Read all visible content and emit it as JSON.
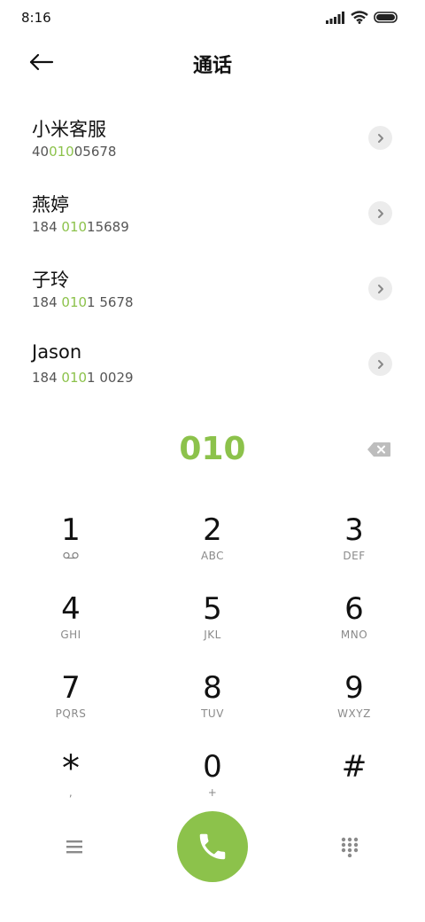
{
  "status_bar": {
    "time": "8:16"
  },
  "header": {
    "title": "通话"
  },
  "contacts": [
    {
      "name": "小米客服",
      "number_pre": "40",
      "number_hl": "010",
      "number_post": "05678"
    },
    {
      "name": "燕婷",
      "number_pre": "184 ",
      "number_hl": "010",
      "number_post": "15689"
    },
    {
      "name": "子玲",
      "number_pre": "184 ",
      "number_hl": "010",
      "number_post": "1 5678"
    },
    {
      "name": "Jason",
      "number_pre": "184 ",
      "number_hl": "010",
      "number_post": "1 0029"
    }
  ],
  "dialed_number": "010",
  "keypad": [
    {
      "digit": "1",
      "letters": ""
    },
    {
      "digit": "2",
      "letters": "ABC"
    },
    {
      "digit": "3",
      "letters": "DEF"
    },
    {
      "digit": "4",
      "letters": "GHI"
    },
    {
      "digit": "5",
      "letters": "JKL"
    },
    {
      "digit": "6",
      "letters": "MNO"
    },
    {
      "digit": "7",
      "letters": "PQRS"
    },
    {
      "digit": "8",
      "letters": "TUV"
    },
    {
      "digit": "9",
      "letters": "WXYZ"
    },
    {
      "digit": "*",
      "letters": ","
    },
    {
      "digit": "0",
      "letters": "+"
    },
    {
      "digit": "#",
      "letters": ""
    }
  ],
  "colors": {
    "accent": "#8cc24b",
    "chevron_bg": "#ececec",
    "secondary_text": "#8a8a8a"
  },
  "icons": {
    "back": "arrow-left-icon",
    "voicemail": "voicemail-icon",
    "backspace": "backspace-icon",
    "call": "phone-icon",
    "menu": "menu-icon",
    "dialpad": "dialpad-icon"
  }
}
